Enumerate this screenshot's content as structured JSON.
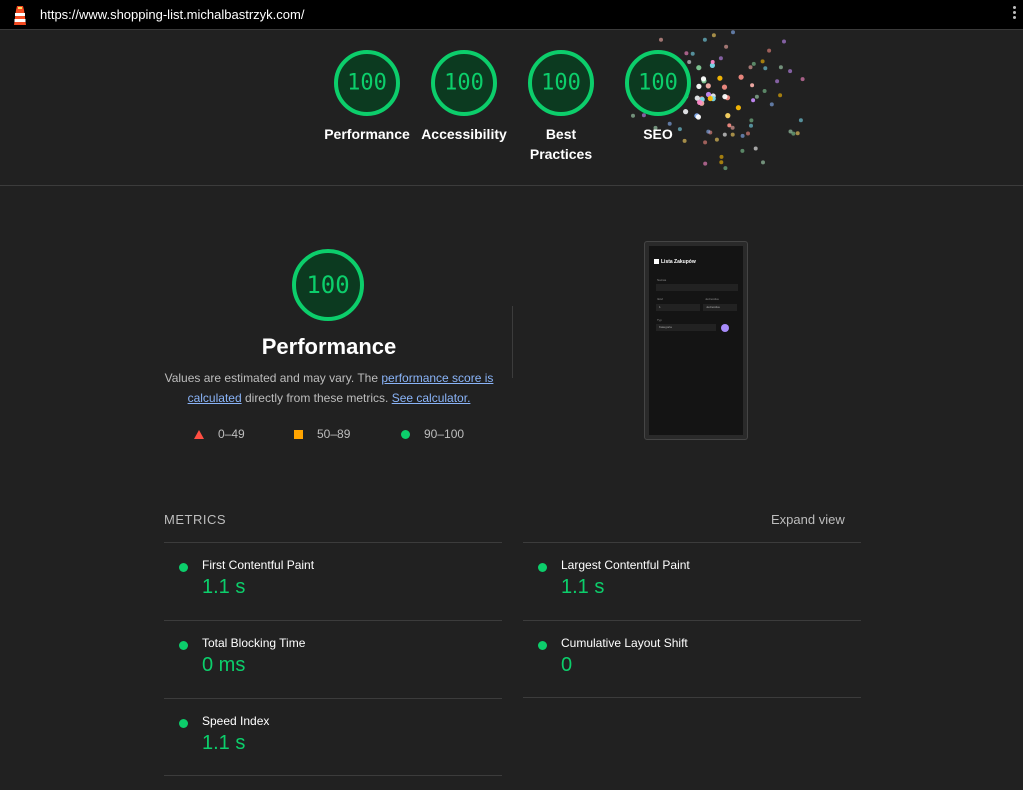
{
  "browser": {
    "url": "https://www.shopping-list.michalbastrzyk.com/"
  },
  "categories": [
    {
      "score": "100",
      "label": "Performance"
    },
    {
      "score": "100",
      "label": "Accessibility"
    },
    {
      "score": "100",
      "label": "Best Practices"
    },
    {
      "score": "100",
      "label": "SEO"
    }
  ],
  "performance": {
    "score": "100",
    "title": "Performance",
    "desc_prefix": "Values are estimated and may vary. The ",
    "link_score": "performance score is calculated",
    "desc_mid": " directly from these metrics. ",
    "link_calc": "See calculator.",
    "legend": {
      "fail": "0–49",
      "average": "50–89",
      "pass": "90–100"
    },
    "colors": {
      "pass": "#0cce6b",
      "average": "#ffa400",
      "fail": "#ff4e42"
    }
  },
  "screenshot": {
    "app_title": "Lista Zakupów",
    "label_name": "Nazwa",
    "label_qty": "Ilość",
    "label_unit": "Jednostka",
    "qty_value": "1",
    "unit_value": "Jednostka",
    "label_type": "Typ",
    "type_value": "Kategoria"
  },
  "metrics": {
    "heading": "METRICS",
    "expand": "Expand view",
    "items": [
      {
        "name": "First Contentful Paint",
        "value": "1.1 s"
      },
      {
        "name": "Largest Contentful Paint",
        "value": "1.1 s"
      },
      {
        "name": "Total Blocking Time",
        "value": "0 ms"
      },
      {
        "name": "Cumulative Layout Shift",
        "value": "0"
      },
      {
        "name": "Speed Index",
        "value": "1.1 s"
      }
    ]
  }
}
